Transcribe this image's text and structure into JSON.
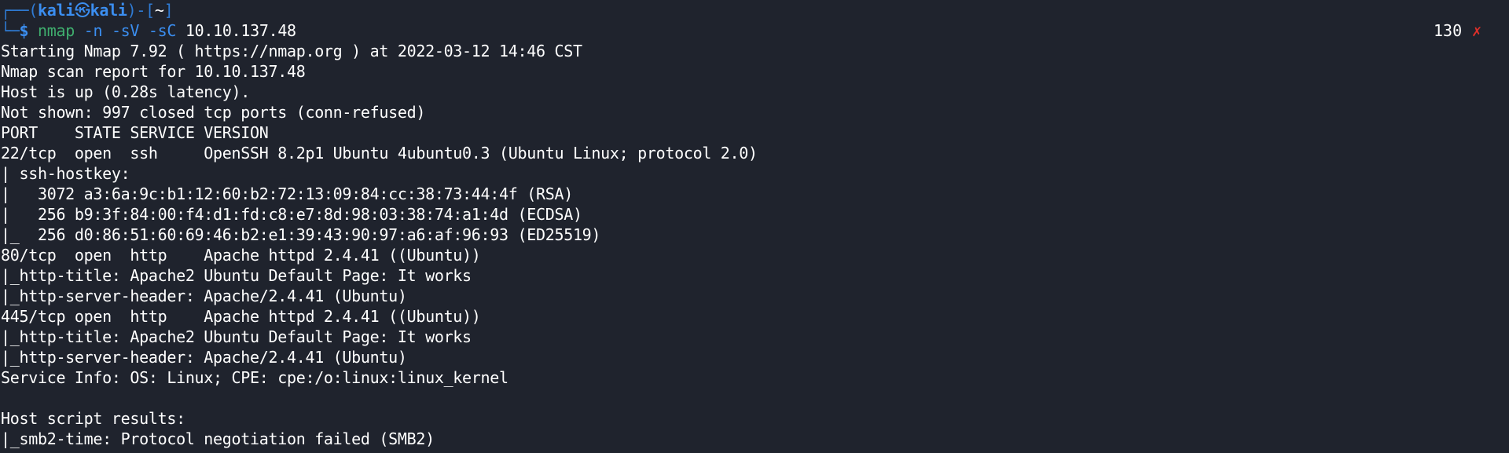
{
  "prompt": {
    "frame_open": "┌──(",
    "user": "kali",
    "separator_icon": "㉿",
    "host": "kali",
    "frame_mid": ")-[",
    "cwd": "~",
    "frame_close": "]",
    "corner": "└─",
    "dollar": "$",
    "command": "nmap",
    "flags": [
      "-n",
      "-sV",
      "-sC"
    ],
    "target": "10.10.137.48"
  },
  "exit_status": {
    "code": "130",
    "icon": "✗"
  },
  "output": [
    "Starting Nmap 7.92 ( https://nmap.org ) at 2022-03-12 14:46 CST",
    "Nmap scan report for 10.10.137.48",
    "Host is up (0.28s latency).",
    "Not shown: 997 closed tcp ports (conn-refused)",
    "PORT    STATE SERVICE VERSION",
    "22/tcp  open  ssh     OpenSSH 8.2p1 Ubuntu 4ubuntu0.3 (Ubuntu Linux; protocol 2.0)",
    "| ssh-hostkey: ",
    "|   3072 a3:6a:9c:b1:12:60:b2:72:13:09:84:cc:38:73:44:4f (RSA)",
    "|   256 b9:3f:84:00:f4:d1:fd:c8:e7:8d:98:03:38:74:a1:4d (ECDSA)",
    "|_  256 d0:86:51:60:69:46:b2:e1:39:43:90:97:a6:af:96:93 (ED25519)",
    "80/tcp  open  http    Apache httpd 2.4.41 ((Ubuntu))",
    "|_http-title: Apache2 Ubuntu Default Page: It works",
    "|_http-server-header: Apache/2.4.41 (Ubuntu)",
    "445/tcp open  http    Apache httpd 2.4.41 ((Ubuntu))",
    "|_http-title: Apache2 Ubuntu Default Page: It works",
    "|_http-server-header: Apache/2.4.41 (Ubuntu)",
    "Service Info: OS: Linux; CPE: cpe:/o:linux:linux_kernel",
    "",
    "Host script results:",
    "|_smb2-time: Protocol negotiation failed (SMB2)"
  ]
}
